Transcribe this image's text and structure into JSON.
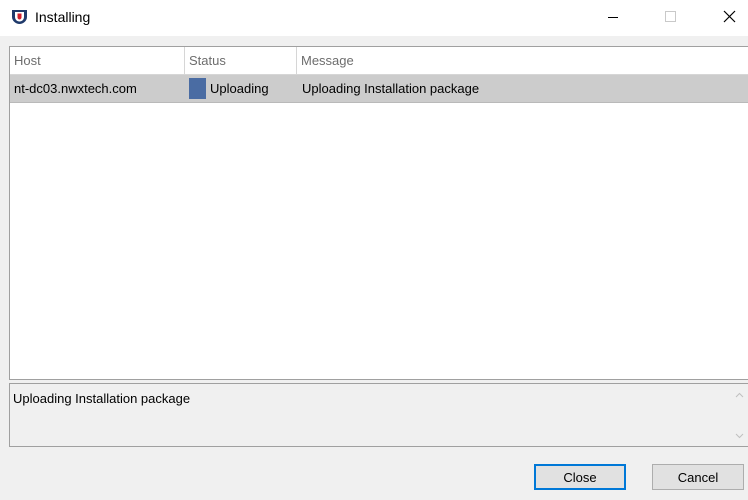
{
  "window": {
    "title": "Installing",
    "app_icon": "shield-logo-icon",
    "controls": [
      "minimize-icon",
      "maximize-icon",
      "close-icon"
    ]
  },
  "grid": {
    "columns": [
      "Host",
      "Status",
      "Message"
    ],
    "rows": [
      {
        "host": "nt-dc03.nwxtech.com",
        "status": "Uploading",
        "message": "Uploading Installation package",
        "status_color": "#4a6ca3"
      }
    ]
  },
  "details": {
    "text": "Uploading Installation package"
  },
  "buttons": {
    "close_label": "Close",
    "cancel_label": "Cancel"
  },
  "colors": {
    "selected_row": "#cccccc",
    "status_swatch": "#4a6ca3",
    "default_button_border": "#0078d7"
  }
}
